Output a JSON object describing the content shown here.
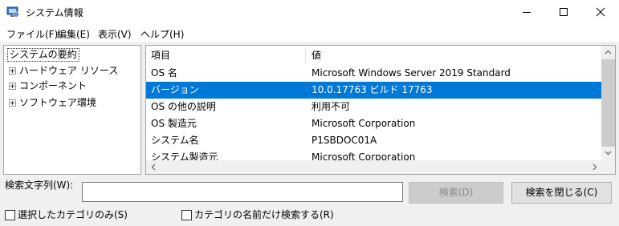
{
  "window": {
    "title": "システム情報",
    "icon": "system-info-icon",
    "controls": [
      "minimize-icon",
      "maximize-icon",
      "close-icon"
    ]
  },
  "menu": [
    "ファイル(F)",
    "編集(E)",
    "表示(V)",
    "ヘルプ(H)"
  ],
  "tree": {
    "root": "システムの要約",
    "items": [
      "ハードウェア リソース",
      "コンポーネント",
      "ソフトウェア環境"
    ]
  },
  "table": {
    "headers": [
      "項目",
      "値"
    ],
    "rows": [
      {
        "item": "OS 名",
        "value": "Microsoft Windows Server 2019 Standard"
      },
      {
        "item": "バージョン",
        "value": "10.0.17763 ビルド 17763",
        "selected": true
      },
      {
        "item": "OS の他の説明",
        "value": "利用不可"
      },
      {
        "item": "OS 製造元",
        "value": "Microsoft Corporation"
      },
      {
        "item": "システム名",
        "value": "P1SBDOC01A"
      },
      {
        "item": "システム製造元",
        "value": "Microsoft Corporation"
      }
    ]
  },
  "search": {
    "label": "検索文字列(W):",
    "value": "",
    "search_button": "検索(D)",
    "close_button": "検索を閉じる(C)"
  },
  "options": {
    "selected_category_only": "選択したカテゴリのみ(S)",
    "category_names_only": "カテゴリの名前だけ検索する(R)"
  },
  "colors": {
    "selection": "#0078d7",
    "window_bg": "#f0f0f0"
  }
}
